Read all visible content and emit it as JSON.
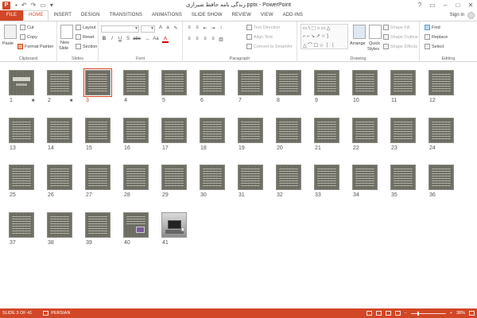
{
  "window": {
    "title": "زندگی نامه حافظ شیرازی.pptx - PowerPoint",
    "app_icon_letter": "P",
    "quick_access": [
      "save-icon",
      "undo-icon",
      "redo-icon",
      "start-from-beginning-icon",
      "customize-icon"
    ],
    "controls": {
      "help": "?",
      "ribbon_options": "▭",
      "minimize": "–",
      "maximize": "□",
      "close": "✕"
    }
  },
  "tabs": [
    "FILE",
    "HOME",
    "INSERT",
    "DESIGN",
    "TRANSITIONS",
    "ANIMATIONS",
    "SLIDE SHOW",
    "REVIEW",
    "VIEW",
    "ADD-INS"
  ],
  "active_tab": "HOME",
  "signin": "Sign in",
  "ribbon": {
    "clipboard": {
      "label": "Clipboard",
      "paste": "Paste",
      "cut": "Cut",
      "copy": "Copy",
      "format_painter": "Format Painter"
    },
    "slides": {
      "label": "Slides",
      "new_slide_1": "New",
      "new_slide_2": "Slide",
      "layout": "Layout",
      "reset": "Reset",
      "section": "Section"
    },
    "font": {
      "label": "Font",
      "bold": "B",
      "italic": "I",
      "underline": "U",
      "shadow": "S",
      "strike": "abc",
      "font_color": "A"
    },
    "paragraph": {
      "label": "Paragraph",
      "text_direction": "Text Direction",
      "align_text": "Align Text",
      "convert_smartart": "Convert to SmartArt"
    },
    "drawing": {
      "label": "Drawing",
      "arrange": "Arrange",
      "quick_styles_1": "Quick",
      "quick_styles_2": "Styles",
      "shape_fill": "Shape Fill",
      "shape_outline": "Shape Outline",
      "shape_effects": "Shape Effects"
    },
    "editing": {
      "label": "Editing",
      "find": "Find",
      "replace": "Replace",
      "select": "Select"
    }
  },
  "slides": [
    {
      "num": "1",
      "star": true
    },
    {
      "num": "2",
      "star": true
    },
    {
      "num": "3"
    },
    {
      "num": "4"
    },
    {
      "num": "5"
    },
    {
      "num": "6"
    },
    {
      "num": "7"
    },
    {
      "num": "8"
    },
    {
      "num": "9"
    },
    {
      "num": "10"
    },
    {
      "num": "11"
    },
    {
      "num": "12"
    },
    {
      "num": "13"
    },
    {
      "num": "14"
    },
    {
      "num": "15"
    },
    {
      "num": "16"
    },
    {
      "num": "17"
    },
    {
      "num": "18"
    },
    {
      "num": "19"
    },
    {
      "num": "20"
    },
    {
      "num": "21"
    },
    {
      "num": "22"
    },
    {
      "num": "23"
    },
    {
      "num": "24"
    },
    {
      "num": "25"
    },
    {
      "num": "26"
    },
    {
      "num": "27"
    },
    {
      "num": "28"
    },
    {
      "num": "29"
    },
    {
      "num": "30"
    },
    {
      "num": "31"
    },
    {
      "num": "32"
    },
    {
      "num": "33"
    },
    {
      "num": "34"
    },
    {
      "num": "35"
    },
    {
      "num": "36"
    },
    {
      "num": "37"
    },
    {
      "num": "38"
    },
    {
      "num": "39"
    },
    {
      "num": "40"
    },
    {
      "num": "41"
    }
  ],
  "selected_slide": "3",
  "star_glyph": "★",
  "status": {
    "slide_info": "SLIDE 3 OF 41",
    "language": "PERSIAN",
    "zoom_minus": "−",
    "zoom_plus": "+",
    "zoom": "38%",
    "zoom_level_pct": 38
  },
  "colors": {
    "accent": "#d24726",
    "slide_bg": "#6b6b62"
  }
}
